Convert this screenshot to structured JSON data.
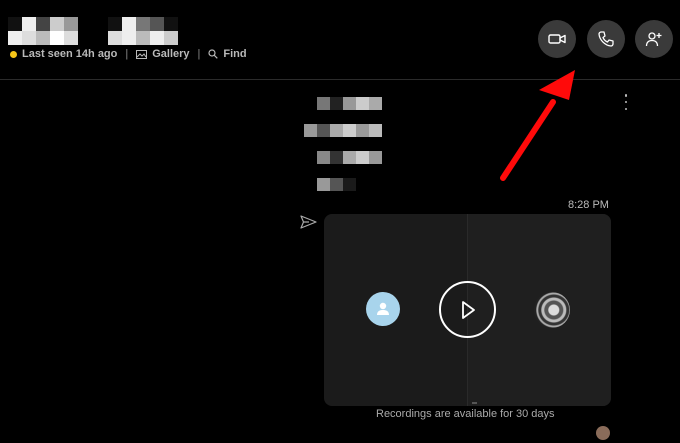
{
  "header": {
    "status": {
      "last_seen": "Last seen 14h ago",
      "gallery": "Gallery",
      "find": "Find"
    },
    "buttons": {
      "video_icon": "video-camera-icon",
      "call_icon": "phone-icon",
      "add_icon": "add-person-icon"
    }
  },
  "conversation": {
    "time": "8:28 PM",
    "recording_note": "Recordings are available for 30 days"
  },
  "colors": {
    "status_dot": "#f5c518",
    "annotation_arrow": "#ff0a0a",
    "avatar": "#a8d4ec"
  }
}
